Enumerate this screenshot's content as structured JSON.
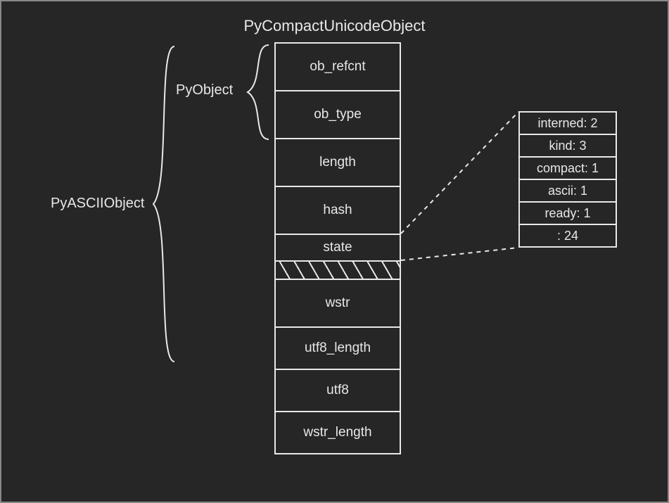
{
  "title": "PyCompactUnicodeObject",
  "labels": {
    "pyascii": "PyASCIIObject",
    "pyobject": "PyObject"
  },
  "fields": {
    "ob_refcnt": "ob_refcnt",
    "ob_type": "ob_type",
    "length": "length",
    "hash": "hash",
    "state": "state",
    "wstr": "wstr",
    "utf8_length": "utf8_length",
    "utf8": "utf8",
    "wstr_length": "wstr_length"
  },
  "state_bits": [
    "interned: 2",
    "kind: 3",
    "compact: 1",
    "ascii: 1",
    "ready: 1",
    " : 24"
  ]
}
